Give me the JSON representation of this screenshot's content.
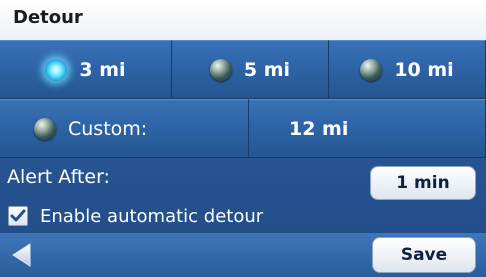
{
  "title": "Detour",
  "distance_options": [
    {
      "label": "3 mi",
      "selected": true
    },
    {
      "label": "5 mi",
      "selected": false
    },
    {
      "label": "10 mi",
      "selected": false
    }
  ],
  "custom": {
    "label": "Custom:",
    "value": "12 mi",
    "selected": false
  },
  "alert": {
    "label": "Alert After:",
    "value": "1 min"
  },
  "auto_detour": {
    "label": "Enable automatic detour",
    "checked": true
  },
  "footer": {
    "save_label": "Save",
    "back_icon": "left-arrow-icon"
  },
  "colors": {
    "panel_blue": "#2a5b98",
    "selected_glow": "#6fe3ff"
  }
}
